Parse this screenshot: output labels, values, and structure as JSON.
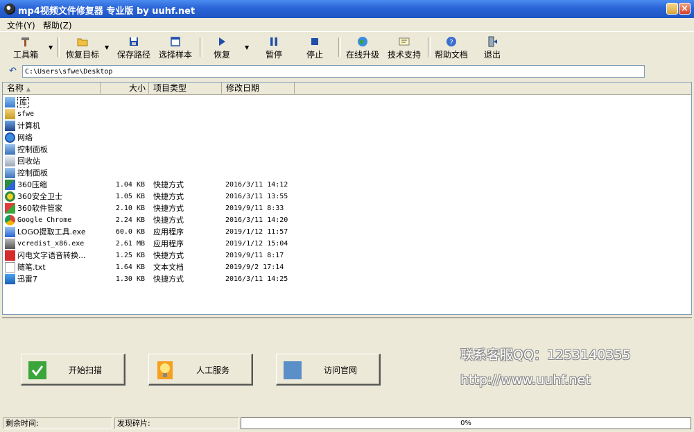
{
  "window": {
    "title": "mp4视频文件修复器 专业版 by uuhf.net"
  },
  "menu": [
    {
      "label": "文件(Y)"
    },
    {
      "label": "帮助(Z)"
    }
  ],
  "toolbar": {
    "toolbox": "工具箱",
    "restore_target": "恢复目标",
    "save_path": "保存路径",
    "choose_sample": "选择样本",
    "restore": "恢复",
    "pause": "暂停",
    "stop": "停止",
    "online_upgrade": "在线升级",
    "tech_support": "技术支持",
    "help_docs": "帮助文档",
    "exit": "退出"
  },
  "path": {
    "value": "C:\\Users\\sfwe\\Desktop"
  },
  "columns": {
    "name": "名称",
    "size": "大小",
    "type": "项目类型",
    "modified": "修改日期"
  },
  "files": [
    {
      "name": "库",
      "size": "",
      "type": "",
      "date": "",
      "icon": "library-icon"
    },
    {
      "name": "sfwe",
      "size": "",
      "type": "",
      "date": "",
      "icon": "user-folder-icon"
    },
    {
      "name": "计算机",
      "size": "",
      "type": "",
      "date": "",
      "icon": "computer-icon"
    },
    {
      "name": "网络",
      "size": "",
      "type": "",
      "date": "",
      "icon": "network-icon"
    },
    {
      "name": "控制面板",
      "size": "",
      "type": "",
      "date": "",
      "icon": "control-panel-icon"
    },
    {
      "name": "回收站",
      "size": "",
      "type": "",
      "date": "",
      "icon": "recycle-bin-icon"
    },
    {
      "name": "控制面板",
      "size": "",
      "type": "",
      "date": "",
      "icon": "control-panel-icon"
    },
    {
      "name": "360压缩",
      "size": "1.04 KB",
      "type": "快捷方式",
      "date": "2016/3/11 14:12",
      "icon": "shortcut-icon"
    },
    {
      "name": "360安全卫士",
      "size": "1.05 KB",
      "type": "快捷方式",
      "date": "2016/3/11 13:55",
      "icon": "shield-icon"
    },
    {
      "name": "360软件管家",
      "size": "2.10 KB",
      "type": "快捷方式",
      "date": "2019/9/11 8:33",
      "icon": "apps-icon"
    },
    {
      "name": "Google Chrome",
      "size": "2.24 KB",
      "type": "快捷方式",
      "date": "2016/3/11 14:20",
      "icon": "chrome-icon"
    },
    {
      "name": "LOGO提取工具.exe",
      "size": "60.0 KB",
      "type": "应用程序",
      "date": "2019/1/12 11:57",
      "icon": "exe-icon"
    },
    {
      "name": "vcredist_x86.exe",
      "size": "2.61 MB",
      "type": "应用程序",
      "date": "2019/1/12 15:04",
      "icon": "installer-icon"
    },
    {
      "name": "闪电文字语音转换...",
      "size": "1.25 KB",
      "type": "快捷方式",
      "date": "2019/9/11 8:17",
      "icon": "speech-icon"
    },
    {
      "name": "随笔.txt",
      "size": "1.64 KB",
      "type": "文本文档",
      "date": "2019/9/2 17:14",
      "icon": "text-file-icon"
    },
    {
      "name": "迅雷7",
      "size": "1.30 KB",
      "type": "快捷方式",
      "date": "2016/3/11 14:25",
      "icon": "thunder-icon"
    }
  ],
  "actions": {
    "start_scan": "开始扫描",
    "manual_service": "人工服务",
    "visit_site": "访问官网"
  },
  "contact": {
    "qq": "联系客服QQ：1253140355",
    "url": "http://www.uuhf.net"
  },
  "status": {
    "remaining_time": "剩余时间:",
    "fragments_found": "发现碎片:",
    "progress_text": "0%",
    "progress_value": 0
  },
  "colors": {
    "titlebar": "#2a64d6",
    "check_green": "#3aa53a",
    "visit_blue": "#5b8fc7"
  }
}
